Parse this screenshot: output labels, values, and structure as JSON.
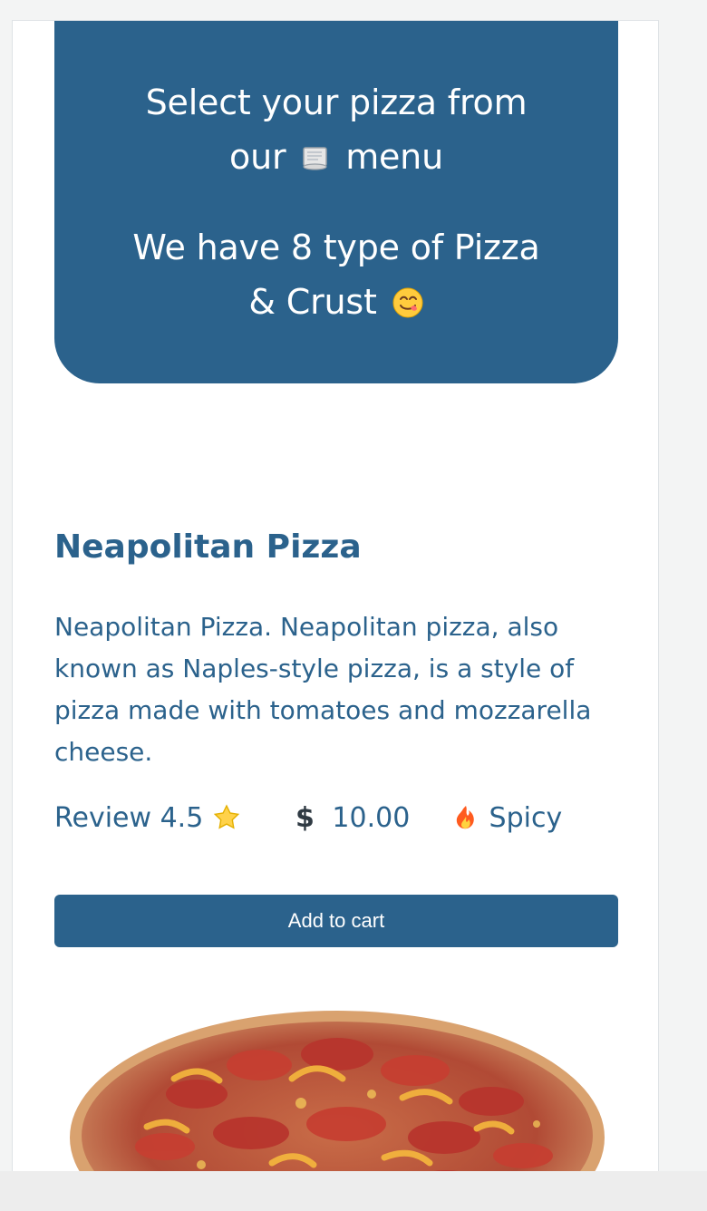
{
  "hero": {
    "line1": "Select your pizza from",
    "line2_before": "our",
    "line2_after": "menu",
    "line3": "We have 8 type of Pizza",
    "line4": "& Crust"
  },
  "product": {
    "title": "Neapolitan Pizza",
    "description": "Neapolitan Pizza. Neapolitan pizza, also known as Naples-style pizza, is a style of pizza made with tomatoes and mozzarella cheese.",
    "review": "Review 4.5",
    "price": "10.00",
    "currency_symbol": "$",
    "spicy_label": "Spicy",
    "button_label": "Add to cart"
  },
  "colors": {
    "primary": "#2b628c",
    "background": "#f3f4f4",
    "card": "#ffffff"
  },
  "icons": [
    "scroll-icon",
    "yum-face-icon",
    "star-icon",
    "dollar-icon",
    "fire-icon"
  ]
}
